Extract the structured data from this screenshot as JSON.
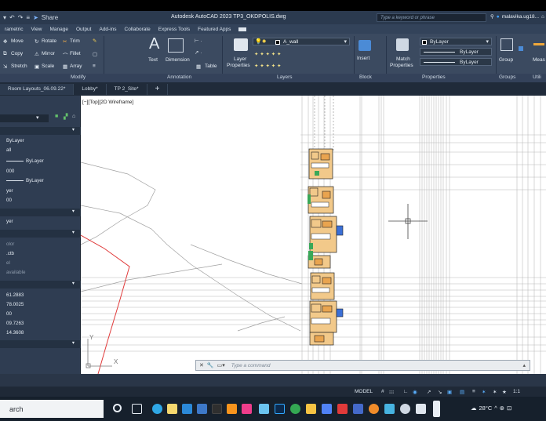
{
  "app": {
    "title": "Autodesk AutoCAD 2023   TP3_OKDPOLIS.dwg",
    "share_label": "Share",
    "search_placeholder": "Type a keyword or phrase",
    "user_name": "malavika.ug18..."
  },
  "ribbon_tabs": [
    "rametric",
    "View",
    "Manage",
    "Output",
    "Add-ins",
    "Collaborate",
    "Express Tools",
    "Featured Apps"
  ],
  "modify_panel": {
    "move": "Move",
    "rotate": "Rotate",
    "trim": "Trim",
    "copy": "Copy",
    "mirror": "Mirror",
    "fillet": "Fillet",
    "stretch": "Stretch",
    "scale": "Scale",
    "array": "Array",
    "label": "Modify"
  },
  "annotation_panel": {
    "text": "Text",
    "dimension": "Dimension",
    "table": "Table",
    "label": "Annotation"
  },
  "layers_panel": {
    "layer_properties_line1": "Layer",
    "layer_properties_line2": "Properties",
    "current_layer": "A_wall",
    "label": "Layers"
  },
  "block_panel": {
    "insert": "Insert",
    "label": "Block"
  },
  "properties_panel": {
    "match_line1": "Match",
    "match_line2": "Properties",
    "color": "ByLayer",
    "linetype": "ByLayer",
    "lineweight": "ByLayer",
    "label": "Properties"
  },
  "groups_panel": {
    "group": "Group",
    "label": "Groups"
  },
  "utilities_panel": {
    "measure": "Meas",
    "label": "Utili"
  },
  "file_tabs": [
    "Room Layouts_06.09.22*",
    "Lobby*",
    "TP 2_Site*"
  ],
  "viewport_label": "[−][Top][2D Wireframe]",
  "properties_palette": {
    "rows": [
      "ByLayer",
      "all",
      "ByLayer",
      "000",
      "ByLayer",
      "yer",
      "00",
      "yer",
      "olor",
      ".ctb",
      "el",
      "available",
      "61.2883",
      "78.0025",
      "00",
      "09.7263",
      "14.3608"
    ]
  },
  "ucs": {
    "y": "Y",
    "x": "X"
  },
  "command_line": {
    "placeholder": "Type a command"
  },
  "status_bar": {
    "model": "MODEL",
    "scale": "1:1"
  },
  "taskbar": {
    "search_text": "arch",
    "temperature": "28°C"
  },
  "colors": {
    "title_bar": "#2b3a4f",
    "ribbon": "#3b4a60",
    "palette": "#2f3d52",
    "canvas": "#ffffff",
    "site_boundary": "#e03a3a",
    "taskbar": "#16202c"
  }
}
